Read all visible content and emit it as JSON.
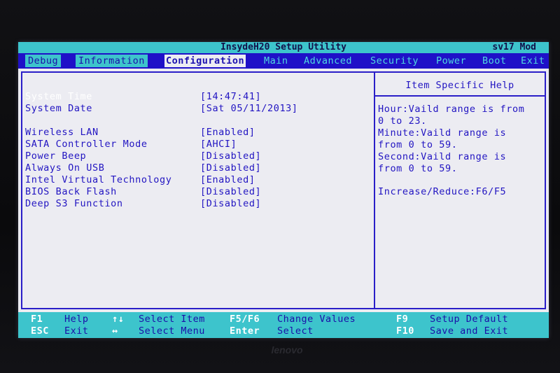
{
  "title": "InsydeH20 Setup Utility",
  "model": "sv17 Mod",
  "menu": [
    "Debug",
    "Information",
    "Configuration",
    "Main",
    "Advanced",
    "Security",
    "Power",
    "Boot",
    "Exit"
  ],
  "settings": [
    {
      "label": "System Time",
      "value": "[14:47:41]"
    },
    {
      "label": "System Date",
      "value": "[Sat 05/11/2013]"
    },
    {
      "label": "Wireless LAN",
      "value": "[Enabled]"
    },
    {
      "label": "SATA Controller Mode",
      "value": "[AHCI]"
    },
    {
      "label": "Power Beep",
      "value": "[Disabled]"
    },
    {
      "label": "Always On USB",
      "value": "[Disabled]"
    },
    {
      "label": "Intel Virtual Technology",
      "value": "[Enabled]"
    },
    {
      "label": "BIOS Back Flash",
      "value": "[Disabled]"
    },
    {
      "label": "Deep S3 Function",
      "value": "[Disabled]"
    }
  ],
  "help": {
    "title": "Item Specific Help",
    "lines": [
      "Hour:Vaild range is from",
      "0 to 23.",
      "Minute:Vaild range is",
      "from 0 to 59.",
      "Second:Vaild range is",
      "from 0 to 59.",
      "Increase/Reduce:F6/F5"
    ]
  },
  "footer": {
    "row1": [
      {
        "key": "F1",
        "label": "Help"
      },
      {
        "key": "↑↓",
        "label": "Select Item"
      },
      {
        "key": "F5/F6",
        "label": "Change Values"
      },
      {
        "key": "F9",
        "label": "Setup Default"
      }
    ],
    "row2": [
      {
        "key": "ESC",
        "label": "Exit"
      },
      {
        "key": "↔",
        "label": "Select Menu"
      },
      {
        "key": "Enter",
        "label": "Select"
      },
      {
        "key": "F10",
        "label": "Save and Exit"
      }
    ]
  },
  "brand": "lenovo",
  "colors": {
    "menu_bg": "#1f10c8",
    "accent": "#3dc4cc",
    "panel_bg": "#ececf2",
    "text": "#2215c2"
  }
}
